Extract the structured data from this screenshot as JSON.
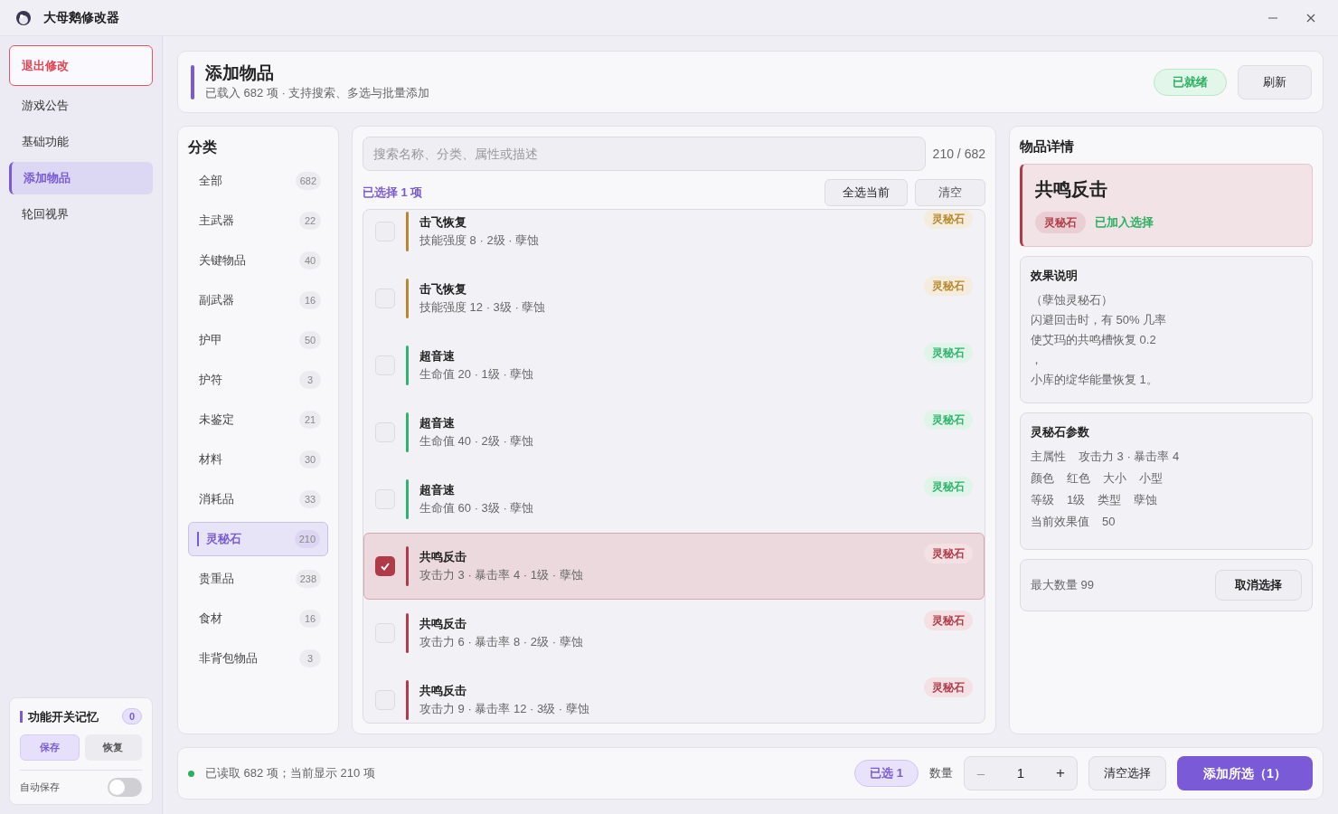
{
  "window": {
    "title": "大母鹅修改器"
  },
  "sidebar": {
    "items": [
      {
        "label": "退出修改",
        "kind": "danger"
      },
      {
        "label": "游戏公告",
        "kind": "nav",
        "selected": false
      },
      {
        "label": "基础功能",
        "kind": "nav",
        "selected": false
      },
      {
        "label": "添加物品",
        "kind": "nav",
        "selected": true
      },
      {
        "label": "轮回视界",
        "kind": "nav",
        "selected": false
      }
    ],
    "memory": {
      "title": "功能开关记忆",
      "count": "0",
      "save": "保存",
      "restore": "恢复",
      "autosave_label": "自动保存",
      "autosave_on": false
    }
  },
  "header": {
    "title": "添加物品",
    "subtitle": "已载入 682 项 · 支持搜索、多选与批量添加",
    "status": "已就绪",
    "refresh": "刷新"
  },
  "categories": {
    "title": "分类",
    "items": [
      {
        "label": "全部",
        "count": "682",
        "selected": false
      },
      {
        "label": "主武器",
        "count": "22",
        "selected": false
      },
      {
        "label": "关键物品",
        "count": "40",
        "selected": false
      },
      {
        "label": "副武器",
        "count": "16",
        "selected": false
      },
      {
        "label": "护甲",
        "count": "50",
        "selected": false
      },
      {
        "label": "护符",
        "count": "3",
        "selected": false
      },
      {
        "label": "未鉴定",
        "count": "21",
        "selected": false
      },
      {
        "label": "材料",
        "count": "30",
        "selected": false
      },
      {
        "label": "消耗品",
        "count": "33",
        "selected": false
      },
      {
        "label": "灵秘石",
        "count": "210",
        "selected": true
      },
      {
        "label": "贵重品",
        "count": "238",
        "selected": false
      },
      {
        "label": "食材",
        "count": "16",
        "selected": false
      },
      {
        "label": "非背包物品",
        "count": "3",
        "selected": false
      }
    ]
  },
  "list": {
    "search_placeholder": "搜索名称、分类、属性或描述",
    "count": "210 / 682",
    "selected_text": "已选择 1 项",
    "select_all": "全选当前",
    "clear": "清空",
    "items": [
      {
        "name": "击飞恢复",
        "meta": "技能强度 8 · 2级 · 孽蚀",
        "tag": "灵秘石",
        "color": "#b8892c",
        "selected": false
      },
      {
        "name": "击飞恢复",
        "meta": "技能强度 12 · 3级 · 孽蚀",
        "tag": "灵秘石",
        "color": "#b8892c",
        "selected": false
      },
      {
        "name": "超音速",
        "meta": "生命值 20 · 1级 · 孽蚀",
        "tag": "灵秘石",
        "color": "#2fb36c",
        "selected": false
      },
      {
        "name": "超音速",
        "meta": "生命值 40 · 2级 · 孽蚀",
        "tag": "灵秘石",
        "color": "#2fb36c",
        "selected": false
      },
      {
        "name": "超音速",
        "meta": "生命值 60 · 3级 · 孽蚀",
        "tag": "灵秘石",
        "color": "#2fb36c",
        "selected": false
      },
      {
        "name": "共鸣反击",
        "meta": "攻击力 3 · 暴击率 4 · 1级 · 孽蚀",
        "tag": "灵秘石",
        "color": "#b03a48",
        "selected": true
      },
      {
        "name": "共鸣反击",
        "meta": "攻击力 6 · 暴击率 8 · 2级 · 孽蚀",
        "tag": "灵秘石",
        "color": "#b03a48",
        "selected": false
      },
      {
        "name": "共鸣反击",
        "meta": "攻击力 9 · 暴击率 12 · 3级 · 孽蚀",
        "tag": "灵秘石",
        "color": "#b03a48",
        "selected": false
      }
    ]
  },
  "details": {
    "title": "物品详情",
    "name": "共鸣反击",
    "tag": "灵秘石",
    "added": "已加入选择",
    "effect_title": "效果说明",
    "effect_lines": [
      "（孽蚀灵秘石）",
      "闪避回击时，有 50% 几率",
      "使艾玛的共鸣槽恢复 0.2",
      "，",
      "小库的绽华能量恢复 1。"
    ],
    "params_title": "灵秘石参数",
    "params": [
      [
        "主属性",
        "攻击力 3 · 暴击率 4"
      ],
      [
        "颜色",
        "红色",
        "大小",
        "小型"
      ],
      [
        "等级",
        "1级",
        "类型",
        "孽蚀"
      ],
      [
        "当前效果值",
        "50"
      ]
    ],
    "max_qty": "最大数量 99",
    "cancel": "取消选择"
  },
  "footer": {
    "status": "已读取 682 项；当前显示 210 项",
    "selected_badge": "已选 1",
    "qty_label": "数量",
    "minus": "–",
    "qty": "1",
    "plus": "+",
    "clear_selection": "清空选择",
    "add": "添加所选（1）"
  }
}
